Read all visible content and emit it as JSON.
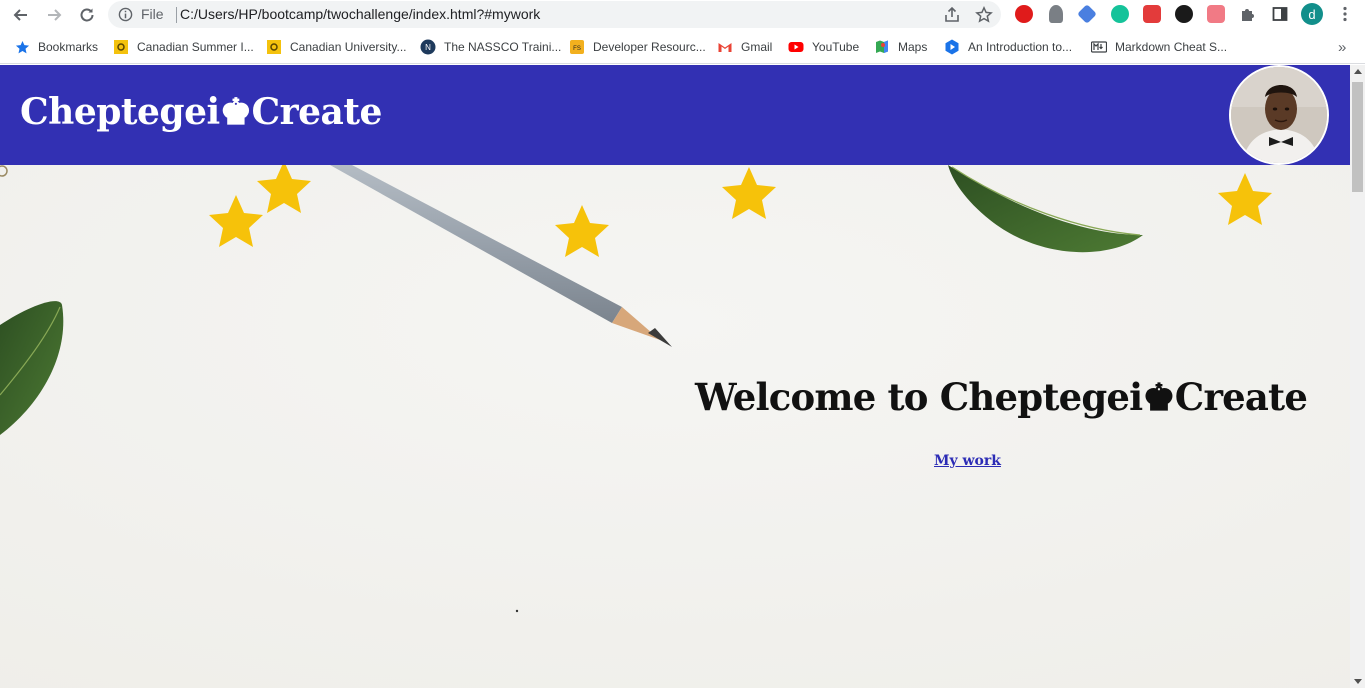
{
  "browser": {
    "scheme_label": "File",
    "url": "C:/Users/HP/bootcamp/twochallenge/index.html?#mywork",
    "profile_initial": "d",
    "bookmarks": [
      {
        "label": "Bookmarks",
        "icon": "star-icon"
      },
      {
        "label": "Canadian Summer I...",
        "icon": "yellow-gear-icon"
      },
      {
        "label": "Canadian University...",
        "icon": "yellow-gear-icon"
      },
      {
        "label": "The NASSCO Traini...",
        "icon": "nassco-icon"
      },
      {
        "label": "Developer Resourc...",
        "icon": "fs-icon"
      },
      {
        "label": "Gmail",
        "icon": "gmail-icon"
      },
      {
        "label": "YouTube",
        "icon": "youtube-icon"
      },
      {
        "label": "Maps",
        "icon": "maps-icon"
      },
      {
        "label": "An Introduction to...",
        "icon": "play-icon"
      },
      {
        "label": "Markdown Cheat S...",
        "icon": "markdown-icon"
      }
    ],
    "overflow_label": "»"
  },
  "site": {
    "brand_prefix": "Cheptegei",
    "brand_icon": "♚",
    "brand_suffix": "Create",
    "welcome_prefix": "Welcome to Cheptegei",
    "welcome_icon": "♚",
    "welcome_suffix": "Create",
    "link_label": "My work"
  },
  "colors": {
    "header_bg": "#3230b3",
    "link": "#2b2bb5",
    "star": "#f6c20a",
    "leaf": "#3f6a2b"
  }
}
